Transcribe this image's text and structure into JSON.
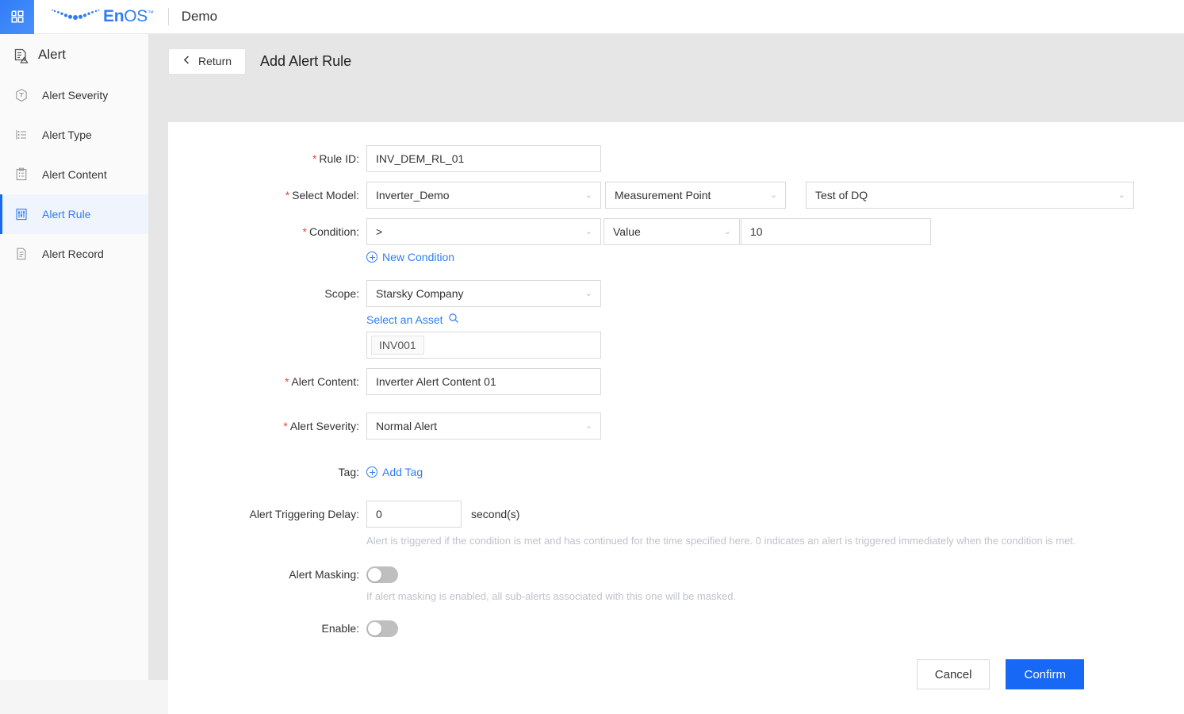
{
  "topbar": {
    "grid_icon": "app-grid-icon",
    "brand_en": "En",
    "brand_os": "OS",
    "brand_tm": "™",
    "workspace": "Demo"
  },
  "sidebar": {
    "header": {
      "label": "Alert",
      "icon": "alert-document-icon"
    },
    "items": [
      {
        "label": "Alert Severity",
        "icon": "severity-hexagon-icon",
        "active": false
      },
      {
        "label": "Alert Type",
        "icon": "list-icon",
        "active": false
      },
      {
        "label": "Alert Content",
        "icon": "clipboard-icon",
        "active": false
      },
      {
        "label": "Alert Rule",
        "icon": "sliders-icon",
        "active": true
      },
      {
        "label": "Alert Record",
        "icon": "file-lines-icon",
        "active": false
      }
    ]
  },
  "page": {
    "return_label": "Return",
    "back_icon": "chevron-left-icon",
    "title": "Add Alert Rule"
  },
  "form": {
    "rule_id": {
      "label": "Rule ID:",
      "required": true,
      "value": "INV_DEM_RL_01"
    },
    "select_model": {
      "label": "Select Model:",
      "required": true,
      "model": "Inverter_Demo",
      "point_type": "Measurement Point",
      "point": "Test of DQ"
    },
    "condition": {
      "label": "Condition:",
      "required": true,
      "operator": ">",
      "kind": "Value",
      "value": "10",
      "new_condition_label": "New Condition",
      "new_condition_icon": "plus-circle-icon"
    },
    "scope": {
      "label": "Scope:",
      "required": false,
      "value": "Starsky Company",
      "select_asset_label": "Select an Asset",
      "search_icon": "search-icon",
      "assets": [
        "INV001"
      ]
    },
    "alert_content": {
      "label": "Alert Content:",
      "required": true,
      "value": "Inverter Alert Content 01"
    },
    "alert_severity": {
      "label": "Alert Severity:",
      "required": true,
      "value": "Normal Alert"
    },
    "tag": {
      "label": "Tag:",
      "required": false,
      "add_tag_label": "Add Tag",
      "add_tag_icon": "plus-circle-icon"
    },
    "trigger_delay": {
      "label": "Alert Triggering Delay:",
      "required": false,
      "value": "0",
      "unit": "second(s)",
      "hint": "Alert is triggered if the condition is met and has continued for the time specified here. 0 indicates an alert is triggered immediately when the condition is met."
    },
    "alert_masking": {
      "label": "Alert Masking:",
      "required": false,
      "enabled": false,
      "hint": "If alert masking is enabled, all sub-alerts associated with this one will be masked."
    },
    "enable": {
      "label": "Enable:",
      "required": false,
      "enabled": false
    }
  },
  "actions": {
    "cancel_label": "Cancel",
    "confirm_label": "Confirm"
  },
  "colors": {
    "accent": "#1668f5",
    "brand_blue": "#2f7df6",
    "required_red": "#e8453c",
    "hint_gray": "#c0c3cc"
  }
}
